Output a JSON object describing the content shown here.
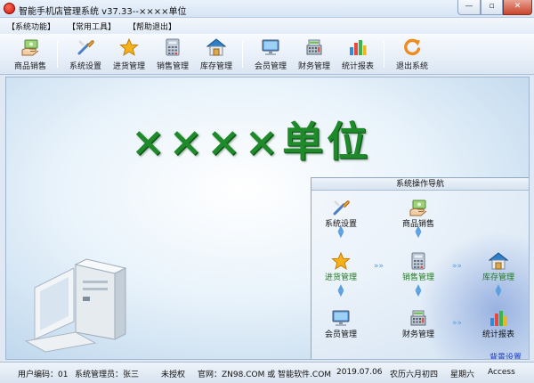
{
  "window": {
    "title": "智能手机店管理系统 v37.33--××××单位"
  },
  "menu": {
    "items": [
      "【系统功能】",
      "【常用工具】",
      "【帮助退出】"
    ]
  },
  "toolbar": {
    "buttons": [
      "商品销售",
      "系统设置",
      "进货管理",
      "销售管理",
      "库存管理",
      "会员管理",
      "财务管理",
      "统计报表",
      "退出系统"
    ]
  },
  "main": {
    "banner": "××××单位"
  },
  "nav": {
    "title": "系统操作导航",
    "nodes": {
      "system_settings": "系统设置",
      "product_sales": "商品销售",
      "purchase": "进货管理",
      "sales": "销售管理",
      "inventory": "库存管理",
      "members": "会员管理",
      "finance": "财务管理",
      "stats": "统计报表"
    },
    "background_settings": "背景设置"
  },
  "status": {
    "user_code": "用户编码：01",
    "operator": "系统管理员：张三",
    "license": "未授权",
    "website": "官网：ZN98.COM 或 智能软件.COM",
    "date": "2019.07.06",
    "lunar": "农历六月初四",
    "weekday": "星期六",
    "db": "Access"
  },
  "colors": {
    "banner": "#1e8a2a",
    "accent": "#1a36c8",
    "close": "#c8452b"
  }
}
